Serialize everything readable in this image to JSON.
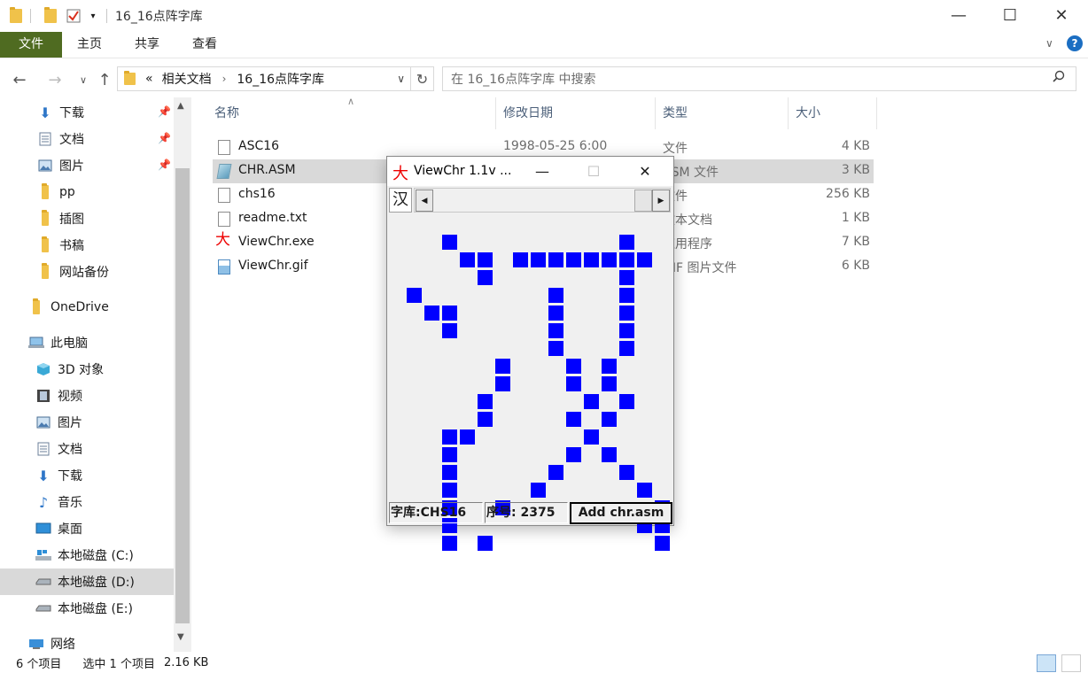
{
  "window": {
    "title": "16_16点阵字库",
    "controls": {
      "minimize": "—",
      "maximize": "☐",
      "close": "✕"
    }
  },
  "ribbon": {
    "tabs": [
      "文件",
      "主页",
      "共享",
      "查看"
    ]
  },
  "address": {
    "prefix": "«",
    "crumbs": [
      "相关文档",
      "16_16点阵字库"
    ],
    "search_placeholder": "在 16_16点阵字库 中搜索"
  },
  "nav": {
    "items": [
      {
        "label": "下载",
        "icon": "download-icon",
        "pinned": true
      },
      {
        "label": "文档",
        "icon": "document-icon",
        "pinned": true
      },
      {
        "label": "图片",
        "icon": "picture-icon",
        "pinned": true
      },
      {
        "label": "pp",
        "icon": "folder-icon"
      },
      {
        "label": "插图",
        "icon": "folder-icon"
      },
      {
        "label": "书稿",
        "icon": "folder-icon"
      },
      {
        "label": "网站备份",
        "icon": "folder-icon"
      },
      {
        "label": "OneDrive",
        "icon": "onedrive-folder-icon"
      },
      {
        "label": "此电脑",
        "icon": "computer-icon"
      },
      {
        "label": "3D 对象",
        "icon": "3d-objects-icon"
      },
      {
        "label": "视频",
        "icon": "video-icon"
      },
      {
        "label": "图片",
        "icon": "picture-icon"
      },
      {
        "label": "文档",
        "icon": "document-icon"
      },
      {
        "label": "下载",
        "icon": "download-icon"
      },
      {
        "label": "音乐",
        "icon": "music-icon"
      },
      {
        "label": "桌面",
        "icon": "desktop-icon"
      },
      {
        "label": "本地磁盘 (C:)",
        "icon": "windows-drive-icon"
      },
      {
        "label": "本地磁盘 (D:)",
        "icon": "drive-icon",
        "selected": true
      },
      {
        "label": "本地磁盘 (E:)",
        "icon": "drive-icon"
      },
      {
        "label": "网络",
        "icon": "network-icon"
      }
    ]
  },
  "list": {
    "columns": [
      "名称",
      "修改日期",
      "类型",
      "大小"
    ],
    "files": [
      {
        "name": "ASC16",
        "date": "1998-05-25 6:00",
        "type": "文件",
        "size": "4 KB",
        "icon": "doc"
      },
      {
        "name": "CHR.ASM",
        "date": "",
        "type": "ASM 文件",
        "size": "3 KB",
        "icon": "asm",
        "selected": true
      },
      {
        "name": "chs16",
        "date": "",
        "type": "文件",
        "size": "256 KB",
        "icon": "doc"
      },
      {
        "name": "readme.txt",
        "date": "",
        "type": "文本文档",
        "size": "1 KB",
        "icon": "doc"
      },
      {
        "name": "ViewChr.exe",
        "date": "",
        "type": "应用程序",
        "size": "7 KB",
        "icon": "exe"
      },
      {
        "name": "ViewChr.gif",
        "date": "",
        "type": "GIF 图片文件",
        "size": "6 KB",
        "icon": "gif"
      }
    ]
  },
  "status": {
    "count": "6 个项目",
    "selection": "选中 1 个项目",
    "size": "2.16 KB"
  },
  "viewchr": {
    "title": "ViewChr 1.1v ...",
    "app_icon_glyph": "大",
    "exe_icon_glyph": "大",
    "preview_char": "汉",
    "font_field": "字库:CHS16",
    "index_field": "序号: 2375",
    "add_button": "Add chr.asm",
    "pixel_color": "#0000ff",
    "bitmap": [
      "0001000000000100",
      "0000110111111110",
      "0000010000000100",
      "0100000001000100",
      "0011000001000100",
      "0001000001000100",
      "0000000001000100",
      "0000001000101000",
      "0000001000101000",
      "0000010000010100",
      "0000010000101000",
      "0001100000010000",
      "0001000000101000",
      "0001000001000100",
      "0001000010000010",
      "0001001000000001",
      "0001000000000011",
      "0001010000000001"
    ]
  }
}
